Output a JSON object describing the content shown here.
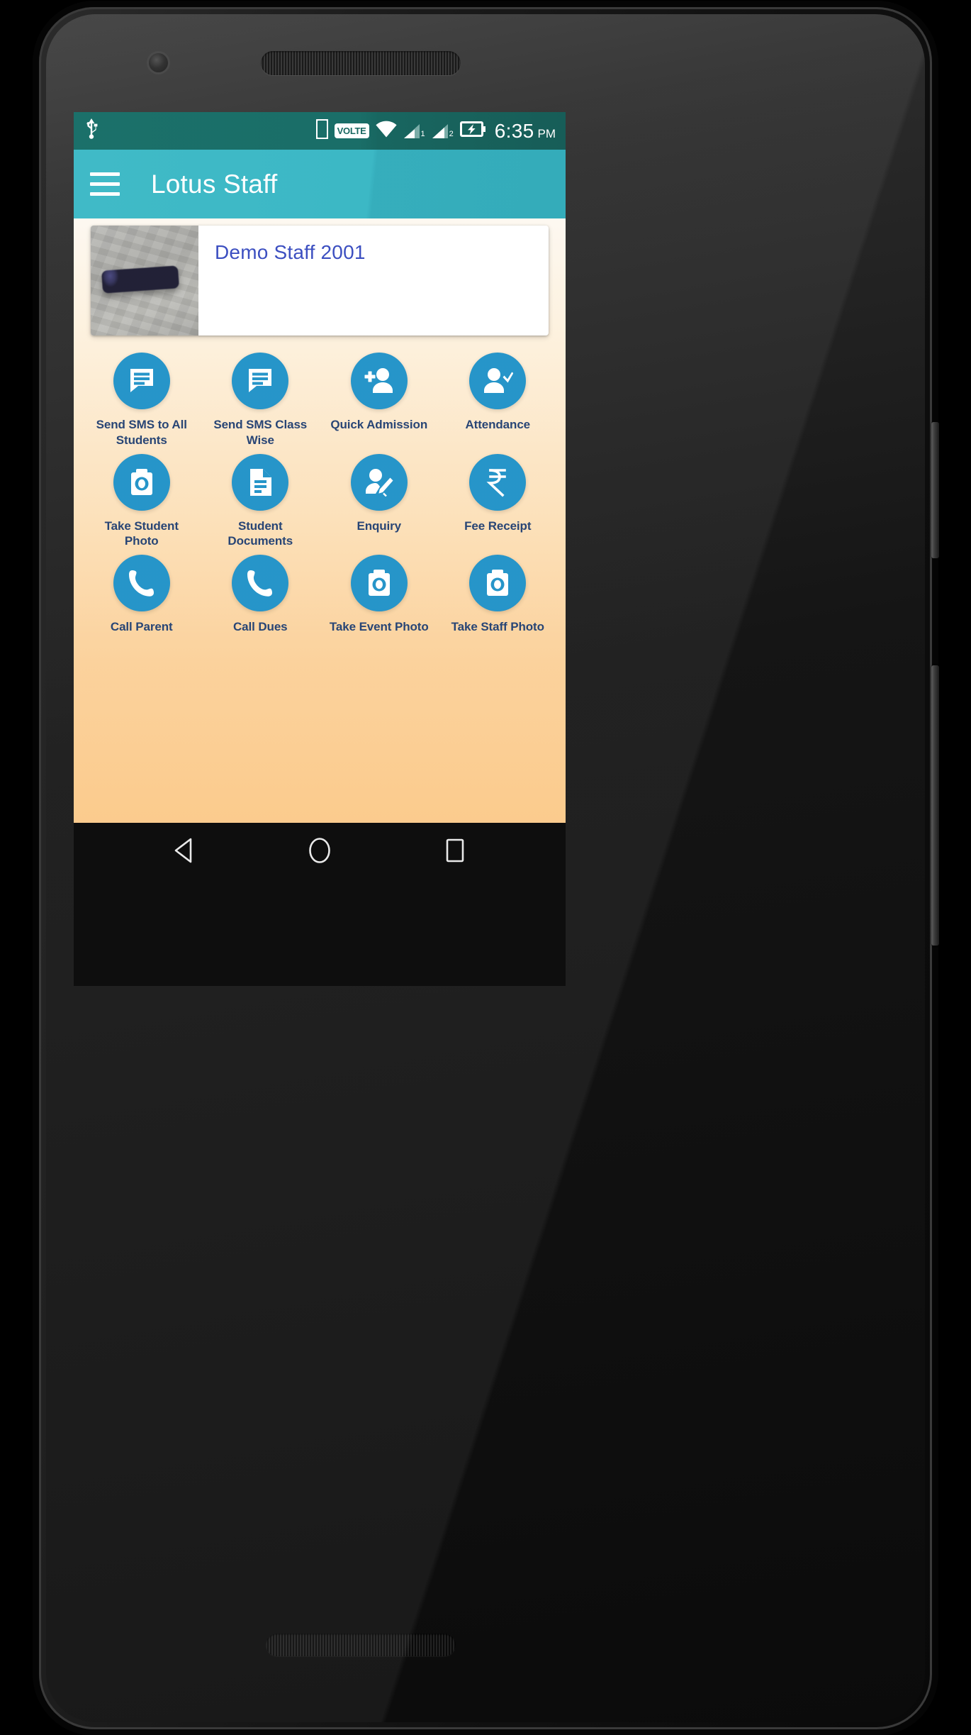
{
  "status_bar": {
    "usb_icon": "usb-icon",
    "phone_icon": "phone-device-icon",
    "volte_label": "VOLTE",
    "wifi_icon": "wifi-icon",
    "sim1_label": "1",
    "sim2_label": "2",
    "battery_icon": "battery-charging-icon",
    "time": "6:35",
    "ampm": "PM"
  },
  "app_bar": {
    "menu_icon": "hamburger-menu-icon",
    "title": "Lotus Staff",
    "background_color": "#31b4c2"
  },
  "staff_card": {
    "name": "Demo Staff 2001",
    "name_color": "#3145bd",
    "photo_icon": "staff-photo-thumbnail"
  },
  "theme": {
    "tile_circle_color": "#1a8fc6",
    "tile_label_color": "#1b3a6d",
    "content_gradient_top": "#fdf8f0",
    "content_gradient_bottom": "#fbc887",
    "status_bar_color": "#0d665f"
  },
  "tiles": [
    {
      "label": "Send SMS to All Students",
      "icon": "message-bubble-icon"
    },
    {
      "label": "Send SMS Class Wise",
      "icon": "message-bubble-icon"
    },
    {
      "label": "Quick Admission",
      "icon": "person-add-icon"
    },
    {
      "label": "Attendance",
      "icon": "person-check-icon"
    },
    {
      "label": "Take Student Photo",
      "icon": "camera-icon"
    },
    {
      "label": "Student Documents",
      "icon": "document-icon"
    },
    {
      "label": "Enquiry",
      "icon": "person-edit-icon"
    },
    {
      "label": "Fee Receipt",
      "icon": "rupee-icon"
    },
    {
      "label": "Call Parent",
      "icon": "phone-call-icon"
    },
    {
      "label": "Call Dues",
      "icon": "phone-call-icon"
    },
    {
      "label": "Take Event Photo",
      "icon": "camera-icon"
    },
    {
      "label": "Take Staff Photo",
      "icon": "camera-icon"
    }
  ],
  "nav_bar": {
    "back": "back-triangle-icon",
    "home": "home-circle-icon",
    "recents": "recents-square-icon"
  }
}
